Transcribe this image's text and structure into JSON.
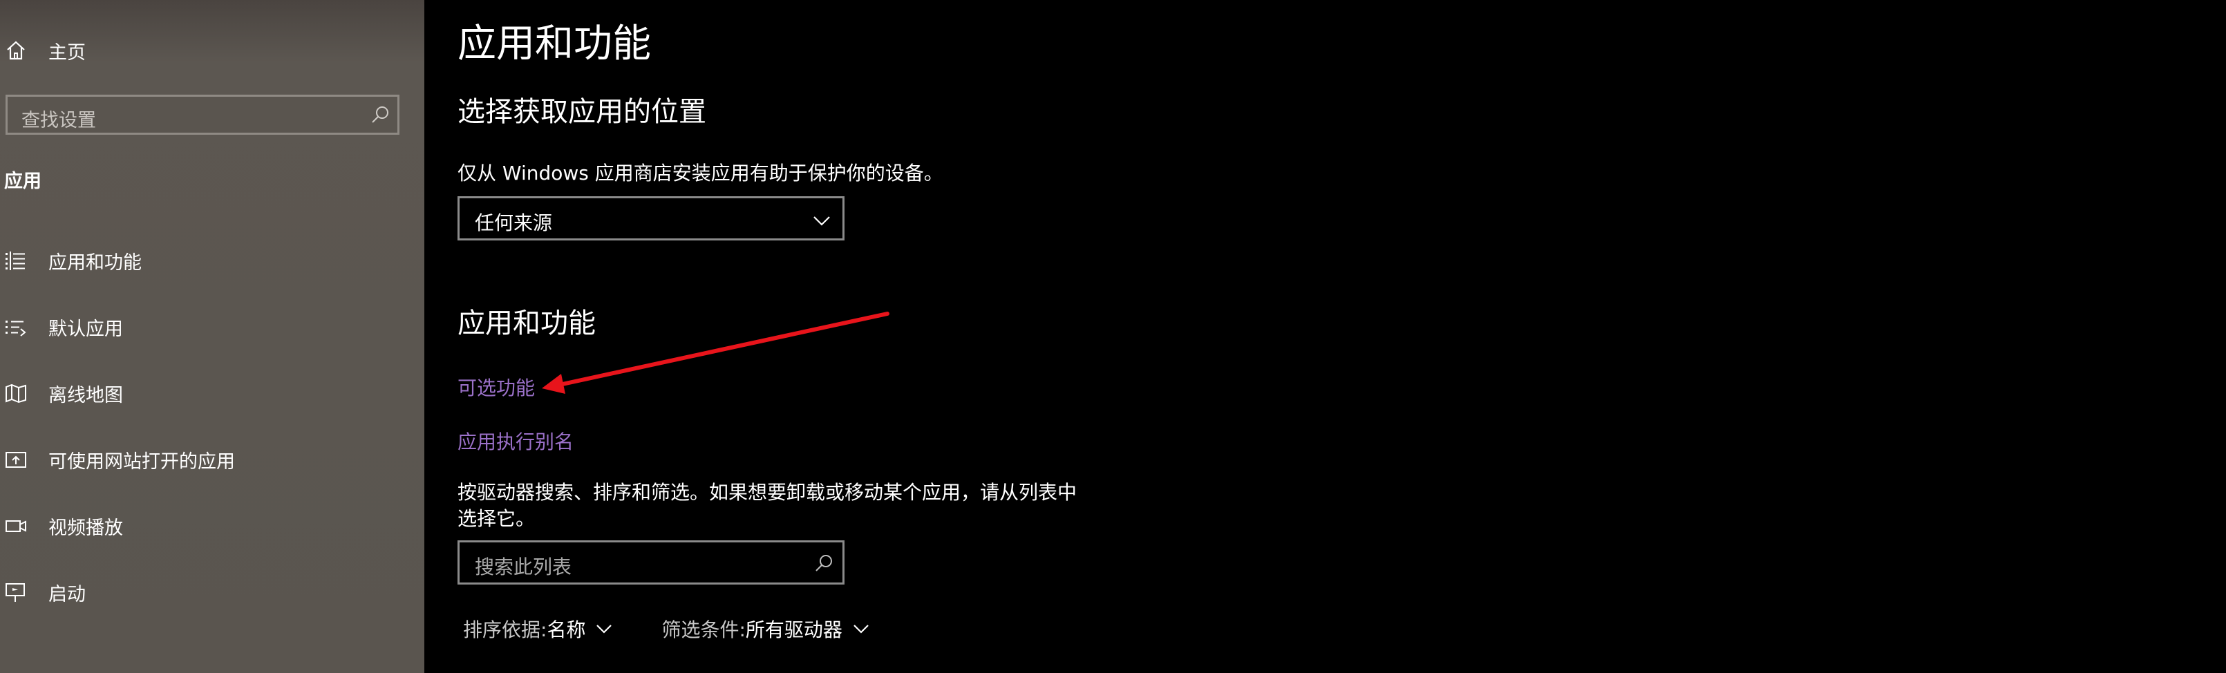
{
  "sidebar": {
    "home_label": "主页",
    "search_placeholder": "查找设置",
    "section_label": "应用",
    "items": [
      {
        "label": "应用和功能",
        "icon": "apps-list-icon"
      },
      {
        "label": "默认应用",
        "icon": "default-apps-icon"
      },
      {
        "label": "离线地图",
        "icon": "map-icon"
      },
      {
        "label": "可使用网站打开的应用",
        "icon": "open-with-website-icon"
      },
      {
        "label": "视频播放",
        "icon": "video-icon"
      },
      {
        "label": "启动",
        "icon": "startup-icon"
      }
    ]
  },
  "main": {
    "title": "应用和功能",
    "section1": {
      "heading": "选择获取应用的位置",
      "description": "仅从 Windows 应用商店安装应用有助于保护你的设备。",
      "dropdown_value": "任何来源"
    },
    "section2": {
      "heading": "应用和功能",
      "link_optional_features": "可选功能",
      "link_app_aliases": "应用执行别名",
      "description": "按驱动器搜索、排序和筛选。如果想要卸载或移动某个应用，请从列表中选择它。",
      "search_placeholder": "搜索此列表",
      "sort_label": "排序依据: ",
      "sort_value": "名称",
      "filter_label": "筛选条件: ",
      "filter_value": "所有驱动器"
    }
  },
  "annotation": {
    "color": "#e8141b"
  },
  "colors": {
    "sidebar_bg": "#5a554f",
    "main_bg": "#000000",
    "link": "#9b71c9"
  }
}
